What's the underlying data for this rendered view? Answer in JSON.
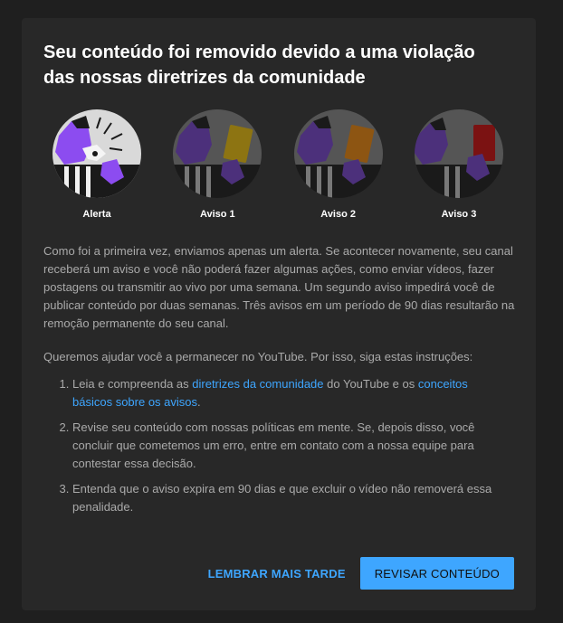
{
  "dialog": {
    "title": "Seu conteúdo foi removido devido a uma violação das nossas diretrizes da comunidade",
    "steps": [
      {
        "label": "Alerta",
        "icon": "alert-illustration-icon",
        "card_color": "#ffffff",
        "active": true
      },
      {
        "label": "Aviso 1",
        "icon": "strike-1-illustration-icon",
        "card_color": "#e0b300",
        "active": false
      },
      {
        "label": "Aviso 2",
        "icon": "strike-2-illustration-icon",
        "card_color": "#e07a00",
        "active": false
      },
      {
        "label": "Aviso 3",
        "icon": "strike-3-illustration-icon",
        "card_color": "#c00000",
        "active": false
      }
    ],
    "paragraph1": "Como foi a primeira vez, enviamos apenas um alerta. Se acontecer novamente, seu canal receberá um aviso e você não poderá fazer algumas ações, como enviar vídeos, fazer postagens ou transmitir ao vivo por uma semana. Um segundo aviso impedirá você de publicar conteúdo por duas semanas. Três avisos em um período de 90 dias resultarão na remoção permanente do seu canal.",
    "paragraph2": "Queremos ajudar você a permanecer no YouTube. Por isso, siga estas instruções:",
    "instructions": [
      {
        "pre": "Leia e compreenda as ",
        "link1": "diretrizes da comunidade",
        "mid": " do YouTube e os ",
        "link2": "conceitos básicos sobre os avisos",
        "post": "."
      },
      {
        "text": "Revise seu conteúdo com nossas políticas em mente. Se, depois disso, você concluir que cometemos um erro, entre em contato com a nossa equipe para contestar essa decisão."
      },
      {
        "text": "Entenda que o aviso expira em 90 dias e que excluir o vídeo não removerá essa penalidade."
      }
    ],
    "buttons": {
      "later": "LEMBRAR MAIS TARDE",
      "review": "REVISAR CONTEÚDO"
    },
    "colors": {
      "accent": "#3ea6ff",
      "background": "#282828",
      "purple": "#8c4cf0"
    }
  }
}
